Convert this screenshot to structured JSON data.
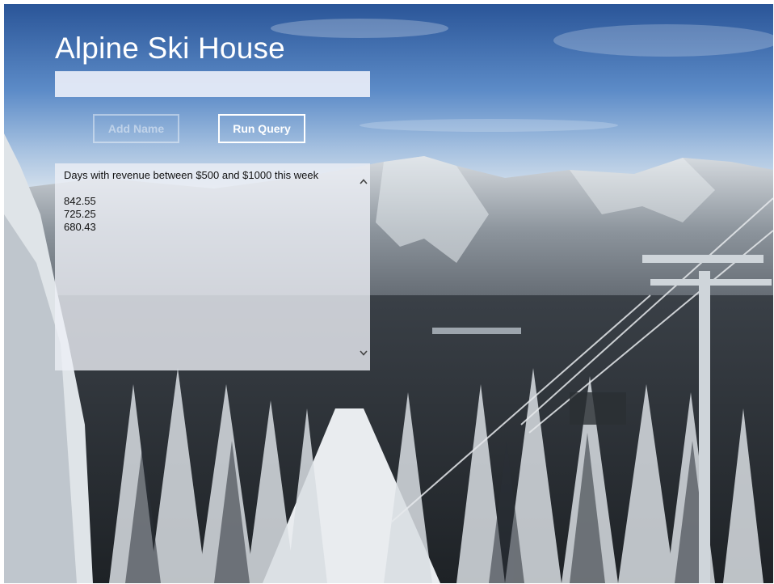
{
  "app": {
    "title": "Alpine Ski House"
  },
  "form": {
    "name_input": {
      "value": "",
      "placeholder": ""
    },
    "add_name_label": "Add Name",
    "run_query_label": "Run Query"
  },
  "results": {
    "header": "Days with revenue between $500 and $1000 this week",
    "values": [
      "842.55",
      "725.25",
      "680.43"
    ]
  },
  "icons": {
    "scroll_up": "chevron-up-icon",
    "scroll_down": "chevron-down-icon"
  },
  "colors": {
    "text_on_image": "#ffffff",
    "input_background": "#e9eef8",
    "results_background": "#eceff5"
  }
}
